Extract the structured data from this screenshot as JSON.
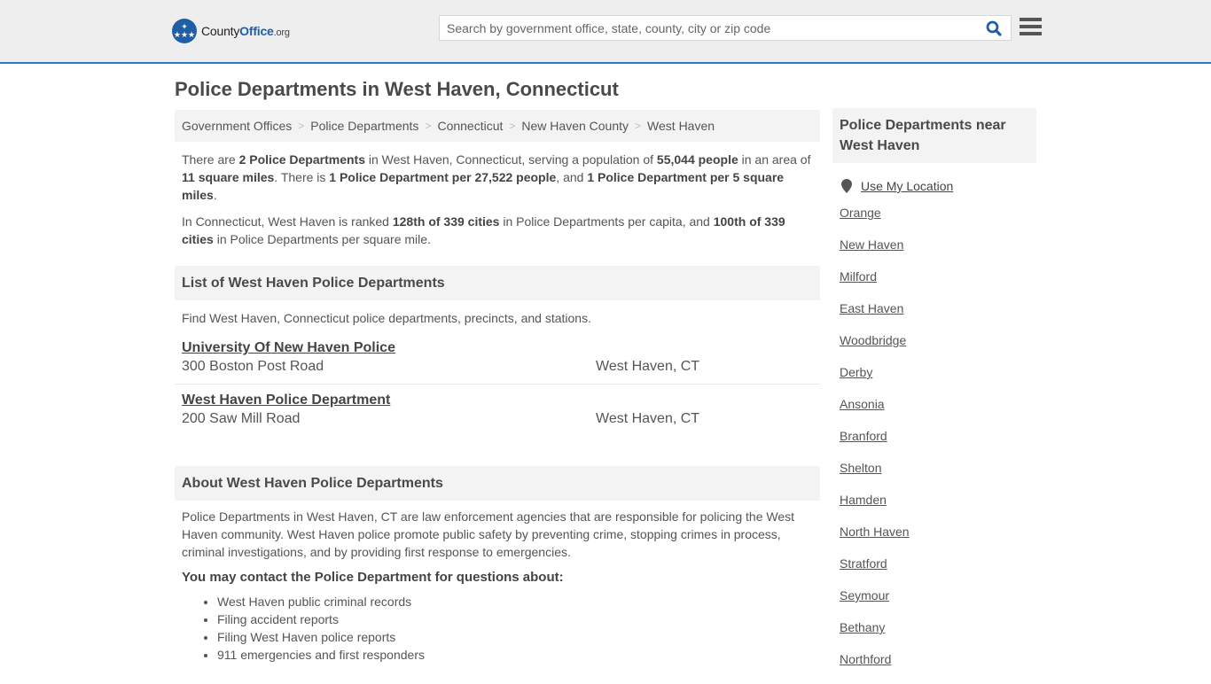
{
  "header": {
    "logo_text_county": "County",
    "logo_text_office": "Office",
    "logo_text_org": ".org",
    "search_placeholder": "Search by government office, state, county, city or zip code",
    "search_value": "",
    "accent_color": "#2f7bbf"
  },
  "page_title": "Police Departments in West Haven, Connecticut",
  "breadcrumb": [
    "Government Offices",
    "Police Departments",
    "Connecticut",
    "New Haven County",
    "West Haven"
  ],
  "intro": {
    "p1": [
      {
        "t": "There are ",
        "b": false
      },
      {
        "t": "2 Police Departments",
        "b": true
      },
      {
        "t": " in West Haven, Connecticut, serving a population of ",
        "b": false
      },
      {
        "t": "55,044 people",
        "b": true
      },
      {
        "t": " in an area of ",
        "b": false
      },
      {
        "t": "11 square miles",
        "b": true
      },
      {
        "t": ". There is ",
        "b": false
      },
      {
        "t": "1 Police Department per 27,522 people",
        "b": true
      },
      {
        "t": ", and ",
        "b": false
      },
      {
        "t": "1 Police Department per 5 square miles",
        "b": true
      },
      {
        "t": ".",
        "b": false
      }
    ],
    "p2": [
      {
        "t": "In Connecticut, West Haven is ranked ",
        "b": false
      },
      {
        "t": "128th of 339 cities",
        "b": true
      },
      {
        "t": " in Police Departments per capita, and ",
        "b": false
      },
      {
        "t": "100th of 339 cities",
        "b": true
      },
      {
        "t": " in Police Departments per square mile.",
        "b": false
      }
    ]
  },
  "list_section": {
    "heading": "List of West Haven Police Departments",
    "description": "Find West Haven, Connecticut police departments, precincts, and stations.",
    "entries": [
      {
        "name": "University Of New Haven Police",
        "address": "300 Boston Post Road",
        "city": "West Haven, CT"
      },
      {
        "name": "West Haven Police Department",
        "address": "200 Saw Mill Road",
        "city": "West Haven, CT"
      }
    ]
  },
  "about_section": {
    "heading": "About West Haven Police Departments",
    "body": "Police Departments in West Haven, CT are law enforcement agencies that are responsible for policing the West Haven community. West Haven police promote public safety by preventing crime, stopping crimes in process, criminal investigations, and by providing first response to emergencies.",
    "contact_heading": "You may contact the Police Department for questions about:",
    "topics": [
      "West Haven public criminal records",
      "Filing accident reports",
      "Filing West Haven police reports",
      "911 emergencies and first responders"
    ]
  },
  "sidebar": {
    "heading": "Police Departments near West Haven",
    "use_location": "Use My Location",
    "cities": [
      "Orange",
      "New Haven",
      "Milford",
      "East Haven",
      "Woodbridge",
      "Derby",
      "Ansonia",
      "Branford",
      "Shelton",
      "Hamden",
      "North Haven",
      "Stratford",
      "Seymour",
      "Bethany",
      "Northford"
    ]
  }
}
